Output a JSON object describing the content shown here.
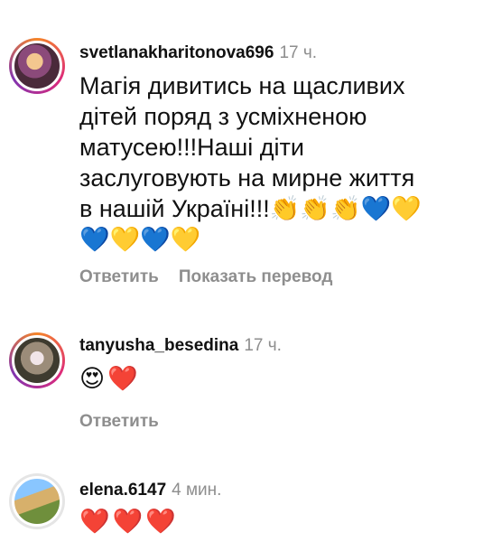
{
  "comments": [
    {
      "username": "svetlanakharitonova696",
      "time": "17 ч.",
      "text": "Магія дивитись на щасливих\nдітей поряд з усміхненою\nматусею!!!Наші діти\nзаслуговують на мирне життя\nв нашій Україні!!!👏👏👏💙💛\n💙💛💙💛",
      "reply_label": "Ответить",
      "translate_label": "Показать перевод"
    },
    {
      "username": "tanyusha_besedina",
      "time": "17 ч.",
      "text": "😍❤️",
      "reply_label": "Ответить"
    },
    {
      "username": "elena.6147",
      "time": "4 мин.",
      "text": "❤️❤️❤️"
    }
  ]
}
